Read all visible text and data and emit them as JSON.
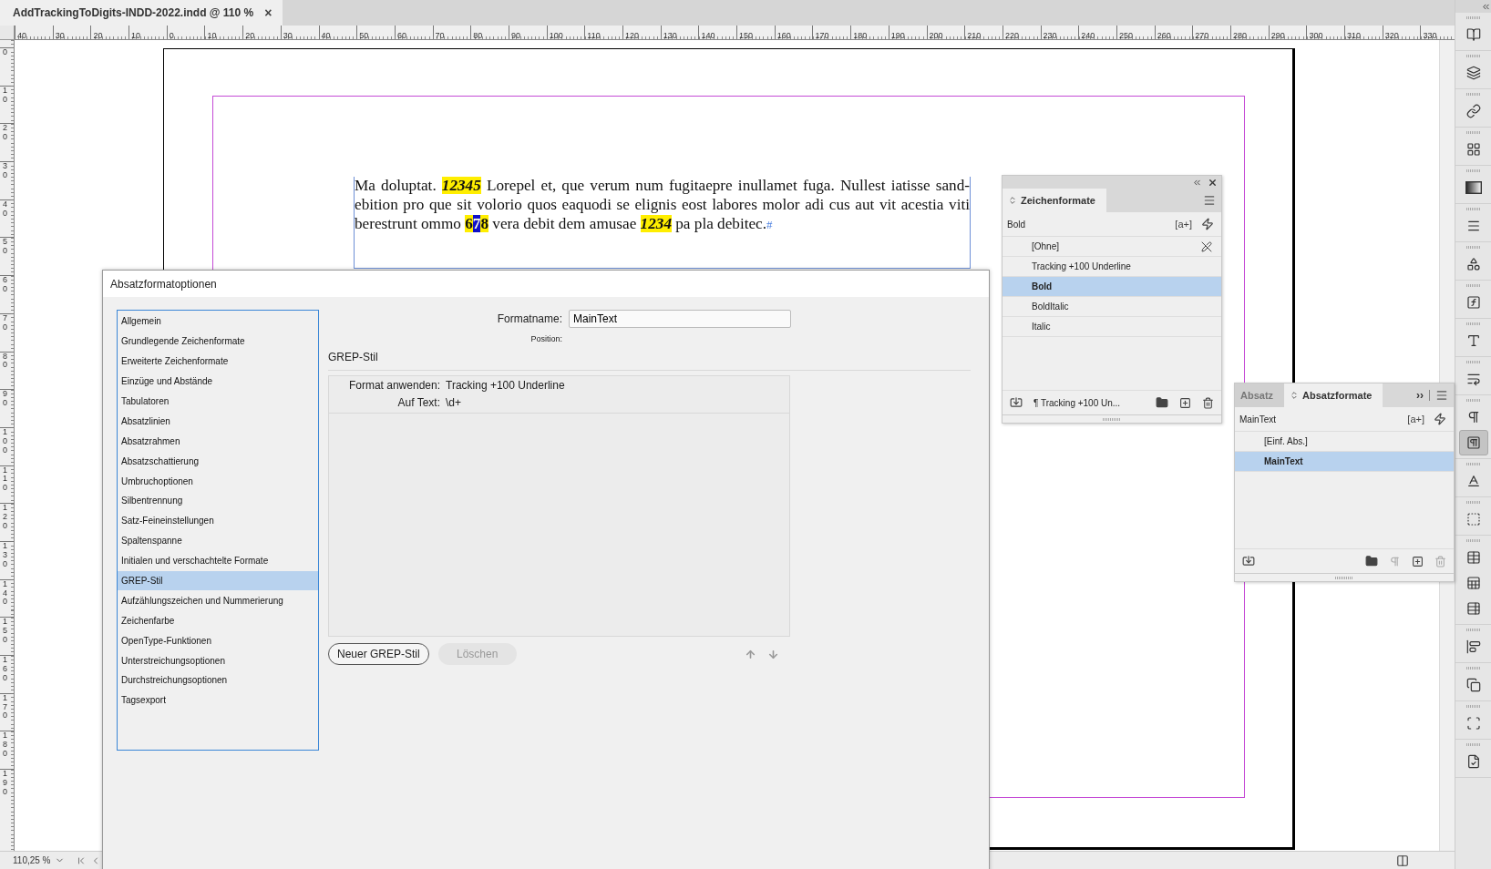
{
  "document_tab": {
    "title": "AddTrackingToDigits-INDD-2022.indd @ 110 %",
    "close": "×"
  },
  "ruler": {
    "horizontal": [
      "40",
      "30",
      "20",
      "10",
      "0",
      "10",
      "20",
      "30",
      "40",
      "50",
      "60",
      "70",
      "80",
      "90",
      "100",
      "110",
      "120",
      "130",
      "140",
      "150",
      "160",
      "170",
      "180",
      "190",
      "200",
      "210",
      "220",
      "230",
      "240",
      "250",
      "260",
      "270",
      "280",
      "290",
      "300",
      "310",
      "320",
      "330"
    ],
    "vertical": [
      "0",
      "10",
      "20",
      "30",
      "40",
      "50",
      "60",
      "70",
      "80",
      "90",
      "100",
      "110",
      "120",
      "130",
      "140",
      "150",
      "160",
      "170",
      "180",
      "190"
    ]
  },
  "text_frame": {
    "lines": [
      [
        {
          "kind": "plain",
          "text": "Ma doluptat. "
        },
        {
          "kind": "digits",
          "text": "12345"
        },
        {
          "kind": "plain",
          "text": " Lorepel et, que verum num fugitaepre inullamet fuga. Nullest iatisse sand-"
        }
      ],
      [
        {
          "kind": "plain",
          "text": "ebition pro que sit volorio quos eaquodi se elignis eost labores molor adi cus aut vit acestia viti"
        }
      ],
      [
        {
          "kind": "plain",
          "text": "berestrunt ommo "
        },
        {
          "kind": "digits-upright",
          "text": "6"
        },
        {
          "kind": "selection",
          "text": "7"
        },
        {
          "kind": "digits-upright",
          "text": "8"
        },
        {
          "kind": "plain",
          "text": " vera debit dem amusae "
        },
        {
          "kind": "digits",
          "text": "1234"
        },
        {
          "kind": "plain",
          "text": " pa pla debitec."
        },
        {
          "kind": "end-mark",
          "text": "#"
        }
      ]
    ]
  },
  "dialog": {
    "title": "Absatzformatoptionen",
    "categories": [
      {
        "label": "Allgemein",
        "selected": false
      },
      {
        "label": "Grundlegende Zeichenformate",
        "selected": false
      },
      {
        "label": "Erweiterte Zeichenformate",
        "selected": false
      },
      {
        "label": "Einzüge und Abstände",
        "selected": false
      },
      {
        "label": "Tabulatoren",
        "selected": false
      },
      {
        "label": "Absatzlinien",
        "selected": false
      },
      {
        "label": "Absatzrahmen",
        "selected": false
      },
      {
        "label": "Absatzschattierung",
        "selected": false
      },
      {
        "label": "Umbruchoptionen",
        "selected": false
      },
      {
        "label": "Silbentrennung",
        "selected": false
      },
      {
        "label": "Satz-Feineinstellungen",
        "selected": false
      },
      {
        "label": "Spaltenspanne",
        "selected": false
      },
      {
        "label": "Initialen und verschachtelte Formate",
        "selected": false
      },
      {
        "label": "GREP-Stil",
        "selected": true
      },
      {
        "label": "Aufzählungszeichen und Nummerierung",
        "selected": false
      },
      {
        "label": "Zeichenfarbe",
        "selected": false
      },
      {
        "label": "OpenType-Funktionen",
        "selected": false
      },
      {
        "label": "Unterstreichungsoptionen",
        "selected": false
      },
      {
        "label": "Durchstreichungsoptionen",
        "selected": false
      },
      {
        "label": "Tagsexport",
        "selected": false
      }
    ],
    "format_name_label": "Formatname:",
    "format_name": "MainText",
    "position_label": "Position:",
    "section_title": "GREP-Stil",
    "grep_styles": [
      {
        "apply_label": "Format anwenden:",
        "apply_value": "Tracking +100 Underline",
        "text_label": "Auf Text:",
        "text_value": "\\d+"
      }
    ],
    "buttons": [
      {
        "label": "Neuer GREP-Stil",
        "disabled": false
      },
      {
        "label": "Löschen",
        "disabled": true
      }
    ]
  },
  "character_styles_panel": {
    "tab": "Zeichenformate",
    "current": "Bold",
    "new_style": "[a+]",
    "items": [
      {
        "label": "[Ohne]",
        "selected": false
      },
      {
        "label": "Tracking +100 Underline",
        "selected": false
      },
      {
        "label": "Bold",
        "selected": true
      },
      {
        "label": "BoldItalic",
        "selected": false
      },
      {
        "label": "Italic",
        "selected": false
      }
    ],
    "footer_label": "¶ Tracking +100 Un..."
  },
  "paragraph_styles_panel": {
    "tabs": [
      {
        "label": "Absatz",
        "selected": false
      },
      {
        "label": "Absatzformate",
        "selected": true
      }
    ],
    "more": "››",
    "current": "MainText",
    "new_style": "[a+]",
    "items": [
      {
        "label": "[Einf. Abs.]",
        "selected": false
      },
      {
        "label": "MainText",
        "selected": true
      }
    ]
  },
  "toolbar": [
    [
      {
        "kind": "pages",
        "selected": false
      }
    ],
    [
      {
        "kind": "layers",
        "selected": false
      }
    ],
    [
      {
        "kind": "links",
        "selected": false
      }
    ],
    [
      {
        "kind": "swatches",
        "selected": false
      }
    ],
    [
      {
        "kind": "gradient",
        "selected": false
      }
    ],
    [
      {
        "kind": "stroke",
        "selected": false
      }
    ],
    [
      {
        "kind": "shapes",
        "selected": false
      }
    ],
    [
      {
        "kind": "effects",
        "selected": false
      }
    ],
    [
      {
        "kind": "glyphs",
        "selected": false
      }
    ],
    [
      {
        "kind": "text-wrap",
        "selected": false
      }
    ],
    [
      {
        "kind": "paragraph",
        "selected": false
      },
      {
        "kind": "paragraph-styles",
        "selected": true
      }
    ],
    [
      {
        "kind": "character-styles",
        "selected": false
      }
    ],
    [
      {
        "kind": "object-styles",
        "selected": false
      }
    ],
    [
      {
        "kind": "table",
        "selected": false
      },
      {
        "kind": "table-styles",
        "selected": false
      },
      {
        "kind": "cell-styles",
        "selected": false
      }
    ],
    [
      {
        "kind": "align",
        "selected": false
      }
    ],
    [
      {
        "kind": "pathfinder",
        "selected": false
      }
    ],
    [
      {
        "kind": "transform",
        "selected": false
      }
    ],
    [
      {
        "kind": "preflight",
        "selected": false
      }
    ]
  ],
  "status_bar": {
    "zoom": "110,25 %"
  }
}
